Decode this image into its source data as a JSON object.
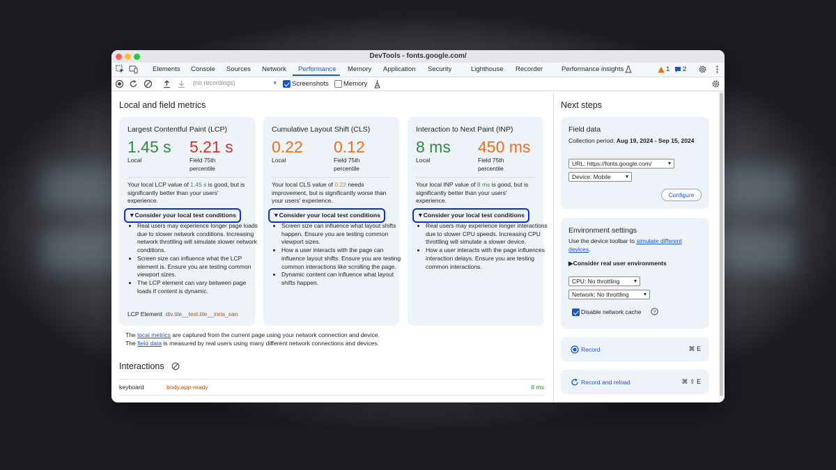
{
  "window": {
    "title": "DevTools - fonts.google.com/"
  },
  "tabs": [
    "Elements",
    "Console",
    "Sources",
    "Network",
    "Performance",
    "Memory",
    "Application",
    "Security",
    "Lighthouse",
    "Recorder",
    "Performance insights"
  ],
  "badges": {
    "warnings": "1",
    "messages": "2"
  },
  "toolbar": {
    "recordings_placeholder": "(no recordings)",
    "screenshots_label": "Screenshots",
    "screenshots_checked": true,
    "memory_label": "Memory",
    "memory_checked": false
  },
  "main": {
    "title": "Local and field metrics",
    "cards": [
      {
        "title": "Largest Contentful Paint (LCP)",
        "local_value": "1.45 s",
        "local_label": "Local",
        "field_value": "5.21 s",
        "field_label_1": "Field 75th",
        "field_label_2": "percentile",
        "desc_pre": "Your local LCP value of ",
        "desc_val": "1.45 s",
        "desc_post": " is good, but is significantly better than your users' experience.",
        "details": "Consider your local test conditions",
        "bullets": [
          "Real users may experience longer page loads due to slower network conditions. Increasing network throttling will simulate slower network conditions.",
          "Screen size can influence what the LCP element is. Ensure you are testing common viewport sizes.",
          "The LCP element can vary between page loads if content is dynamic."
        ],
        "lcp_element_label": "LCP Element",
        "lcp_element_value": "div.tile__text.tile__inria_san"
      },
      {
        "title": "Cumulative Layout Shift (CLS)",
        "local_value": "0.22",
        "local_label": "Local",
        "field_value": "0.12",
        "field_label_1": "Field 75th",
        "field_label_2": "percentile",
        "desc_pre": "Your local CLS value of ",
        "desc_val": "0.22",
        "desc_post": " needs improvement, but is significantly worse than your users' experience.",
        "details": "Consider your local test conditions",
        "bullets": [
          "Screen size can influence what layout shifts happen. Ensure you are testing common viewport sizes.",
          "How a user interacts with the page can influence layout shifts. Ensure you are testing common interactions like scrolling the page.",
          "Dynamic content can influence what layout shifts happen."
        ]
      },
      {
        "title": "Interaction to Next Paint (INP)",
        "local_value": "8 ms",
        "local_label": "Local",
        "field_value": "450 ms",
        "field_label_1": "Field 75th",
        "field_label_2": "percentile",
        "desc_pre": "Your local INP value of ",
        "desc_val": "8 ms",
        "desc_post": " is good, but is significantly better than your users' experience.",
        "details": "Consider your local test conditions",
        "bullets": [
          "Real users may experience longer interactions due to slower CPU speeds. Increasing CPU throttling will simulate a slower device.",
          "How a user interacts with the page influences interaction delays. Ensure you are testing common interactions."
        ]
      }
    ],
    "note1_pre": "The ",
    "note1_link": "local metrics",
    "note1_post": " are captured from the current page using your network connection and device.",
    "note2_pre": "The ",
    "note2_link": "field data",
    "note2_post": " is measured by real users using many different network connections and devices.",
    "interactions_title": "Interactions",
    "interaction_row": {
      "type": "keyboard",
      "target": "body.app-ready",
      "duration": "8 ms"
    }
  },
  "side": {
    "title": "Next steps",
    "field_data": {
      "title": "Field data",
      "period_label": "Collection period: ",
      "period_value": "Aug 19, 2024 - Sep 15, 2024",
      "url_select": "URL: https://fonts.google.com/",
      "device_select": "Device: Mobile",
      "configure_label": "Configure"
    },
    "env": {
      "title": "Environment settings",
      "text_pre": "Use the device toolbar to ",
      "text_link": "simulate different devices",
      "text_post": ".",
      "details": "Consider real user environments",
      "cpu_select": "CPU: No throttling",
      "network_select": "Network: No throttling",
      "cache_label": "Disable network cache",
      "cache_checked": true
    },
    "record": {
      "label": "Record",
      "shortcut": "⌘ E"
    },
    "record_reload": {
      "label": "Record and reload",
      "shortcut": "⌘ ⇧ E"
    }
  },
  "colors": {
    "good": "#2e8b3d",
    "poor": "#d93025",
    "needs_improvement": "#e8711a",
    "accent": "#1a56c8",
    "highlight_box": "#0b2fd6"
  }
}
